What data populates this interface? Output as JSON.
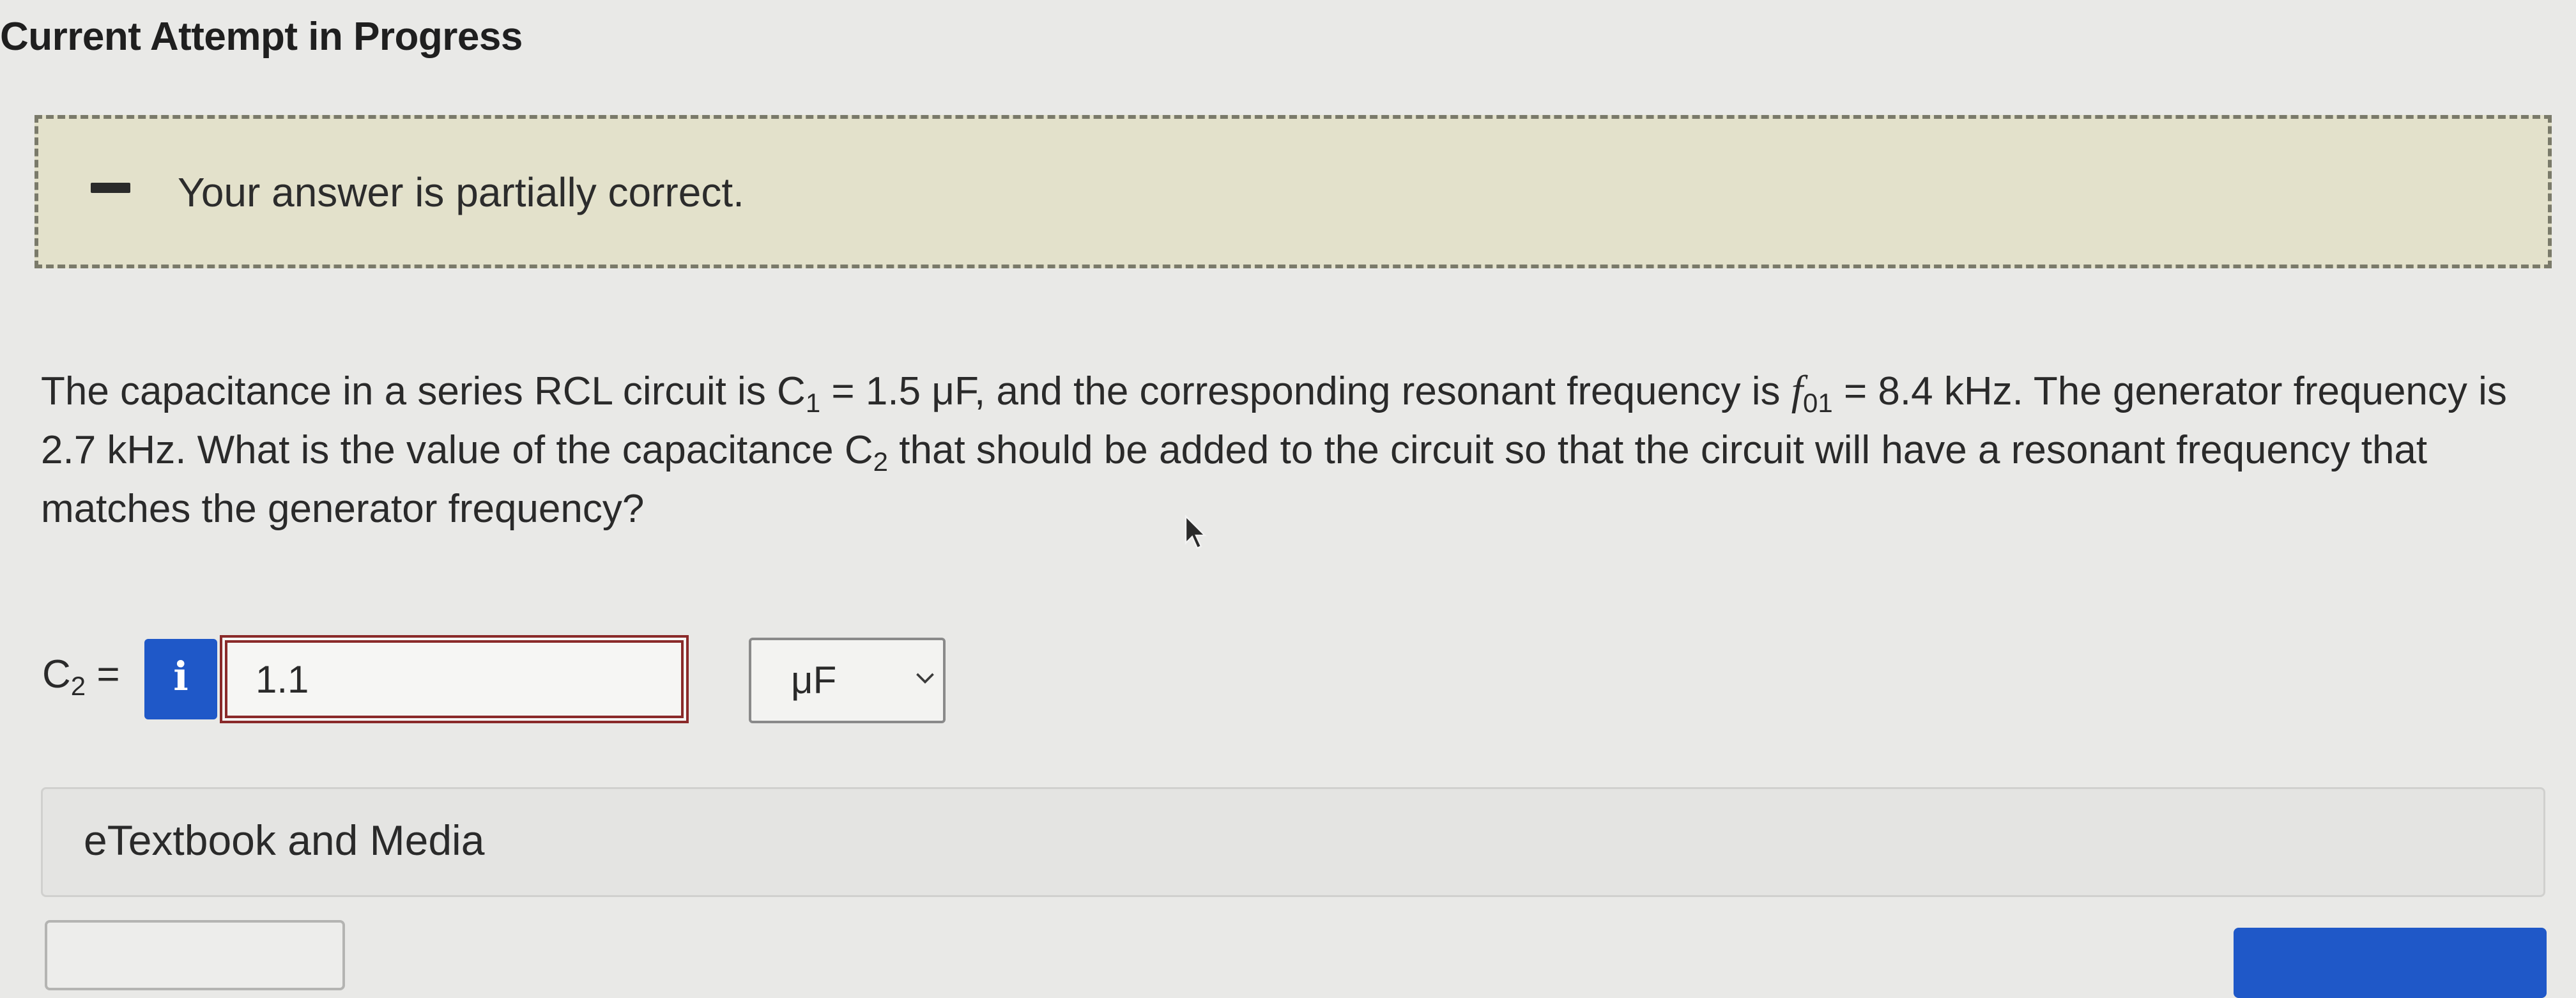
{
  "header": {
    "title": "Current Attempt in Progress"
  },
  "feedback": {
    "icon": "dash-icon",
    "message": "Your answer is partially correct."
  },
  "question": {
    "text_1": "The capacitance in a series RCL circuit is C",
    "sub_1": "1",
    "text_2": " = 1.5 μF, and the corresponding resonant frequency is ",
    "f_symbol": "f",
    "sub_2": "01",
    "text_3": " = 8.4 kHz. The generator frequency is 2.7 kHz. What is the value of the capacitance C",
    "sub_3": "2",
    "text_4": " that should be added to the circuit so that the circuit will have a resonant frequency that matches the generator frequency?"
  },
  "answer": {
    "label_main": "C",
    "label_sub": "2",
    "label_eq": " =",
    "info_glyph": "i",
    "value": "1.1",
    "unit": "μF",
    "input_border_color": "#8a2a2a"
  },
  "etextbook": {
    "label": "eTextbook and Media"
  },
  "colors": {
    "accent": "#1f58c8",
    "feedback_bg": "#e3e1cb",
    "page_bg": "#e9e9e7"
  }
}
